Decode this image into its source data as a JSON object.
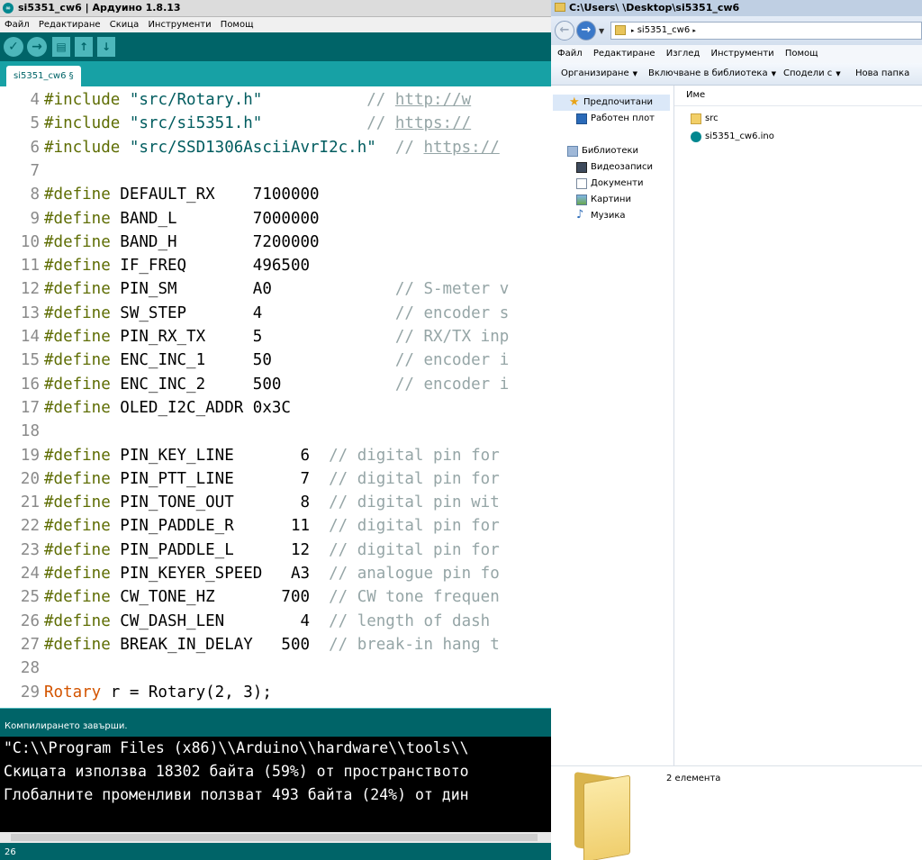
{
  "arduino": {
    "title": "si5351_cw6 | Ардуино 1.8.13",
    "menu": [
      "Файл",
      "Редактиране",
      "Скица",
      "Инструменти",
      "Помощ"
    ],
    "toolbar_icons": [
      "verify-icon",
      "upload-icon",
      "new-icon",
      "open-icon",
      "save-icon"
    ],
    "tab": "si5351_cw6 §",
    "lines": [
      {
        "n": "4",
        "pre": "#include",
        "rest": " ",
        "str": "\"src/Rotary.h\"",
        "pad": "           ",
        "cmt": "// ",
        "link": "http://w"
      },
      {
        "n": "5",
        "pre": "#include",
        "rest": " ",
        "str": "\"src/si5351.h\"",
        "pad": "           ",
        "cmt": "// ",
        "link": "https://"
      },
      {
        "n": "6",
        "pre": "#include",
        "rest": " ",
        "str": "\"src/SSD1306AsciiAvrI2c.h\"",
        "pad": "  ",
        "cmt": "// ",
        "link": "https://"
      },
      {
        "n": "7"
      },
      {
        "n": "8",
        "pre": "#define",
        "rest": " DEFAULT_RX    7100000"
      },
      {
        "n": "9",
        "pre": "#define",
        "rest": " BAND_L        7000000"
      },
      {
        "n": "10",
        "pre": "#define",
        "rest": " BAND_H        7200000"
      },
      {
        "n": "11",
        "pre": "#define",
        "rest": " IF_FREQ       496500"
      },
      {
        "n": "12",
        "pre": "#define",
        "rest": " PIN_SM        A0             ",
        "cmt": "// S-meter v"
      },
      {
        "n": "13",
        "pre": "#define",
        "rest": " SW_STEP       4              ",
        "cmt": "// encoder s"
      },
      {
        "n": "14",
        "pre": "#define",
        "rest": " PIN_RX_TX     5              ",
        "cmt": "// RX/TX inp"
      },
      {
        "n": "15",
        "pre": "#define",
        "rest": " ENC_INC_1     50             ",
        "cmt": "// encoder i"
      },
      {
        "n": "16",
        "pre": "#define",
        "rest": " ENC_INC_2     500            ",
        "cmt": "// encoder i"
      },
      {
        "n": "17",
        "pre": "#define",
        "rest": " OLED_I2C_ADDR 0x3C"
      },
      {
        "n": "18"
      },
      {
        "n": "19",
        "pre": "#define",
        "rest": " PIN_KEY_LINE       6  ",
        "cmt": "// digital pin for"
      },
      {
        "n": "20",
        "pre": "#define",
        "rest": " PIN_PTT_LINE       7  ",
        "cmt": "// digital pin for"
      },
      {
        "n": "21",
        "pre": "#define",
        "rest": " PIN_TONE_OUT       8  ",
        "cmt": "// digital pin wit"
      },
      {
        "n": "22",
        "pre": "#define",
        "rest": " PIN_PADDLE_R      11  ",
        "cmt": "// digital pin for"
      },
      {
        "n": "23",
        "pre": "#define",
        "rest": " PIN_PADDLE_L      12  ",
        "cmt": "// digital pin for"
      },
      {
        "n": "24",
        "pre": "#define",
        "rest": " PIN_KEYER_SPEED   A3  ",
        "cmt": "// analogue pin fo"
      },
      {
        "n": "25",
        "pre": "#define",
        "rest": " CW_TONE_HZ       700  ",
        "cmt": "// CW tone frequen"
      },
      {
        "n": "26",
        "pre": "#define",
        "rest": " CW_DASH_LEN        4  ",
        "cmt": "// length of dash "
      },
      {
        "n": "27",
        "pre": "#define",
        "rest": " BREAK_IN_DELAY   500  ",
        "cmt": "// break-in hang t"
      },
      {
        "n": "28"
      },
      {
        "n": "29",
        "type": "Rotary",
        "rest": " r = Rotary(2, 3);"
      }
    ],
    "console_header": "Компилирането завърши.",
    "console_lines": [
      "\"C:\\\\Program Files (x86)\\\\Arduino\\\\hardware\\\\tools\\\\",
      "Скицата използва 18302 байта (59%) от пространството",
      "Глобалните променливи ползват 493 байта (24%) от дин"
    ],
    "status_line": "26"
  },
  "explorer": {
    "title": "C:\\Users\\        \\Desktop\\si5351_cw6",
    "address": "si5351_cw6",
    "menu": [
      "Файл",
      "Редактиране",
      "Изглед",
      "Инструменти",
      "Помощ"
    ],
    "commands": [
      "Организиране",
      "Включване в библиотека",
      "Сподели с",
      "Нова папка"
    ],
    "nav": {
      "favorites": "Предпочитани",
      "desktop": "Работен плот",
      "libraries": "Библиотеки",
      "videos": "Видеозаписи",
      "documents": "Документи",
      "pictures": "Картини",
      "music": "Музика"
    },
    "column_name": "Име",
    "files": [
      "src",
      "si5351_cw6.ino"
    ],
    "item_count": "2 елемента"
  }
}
